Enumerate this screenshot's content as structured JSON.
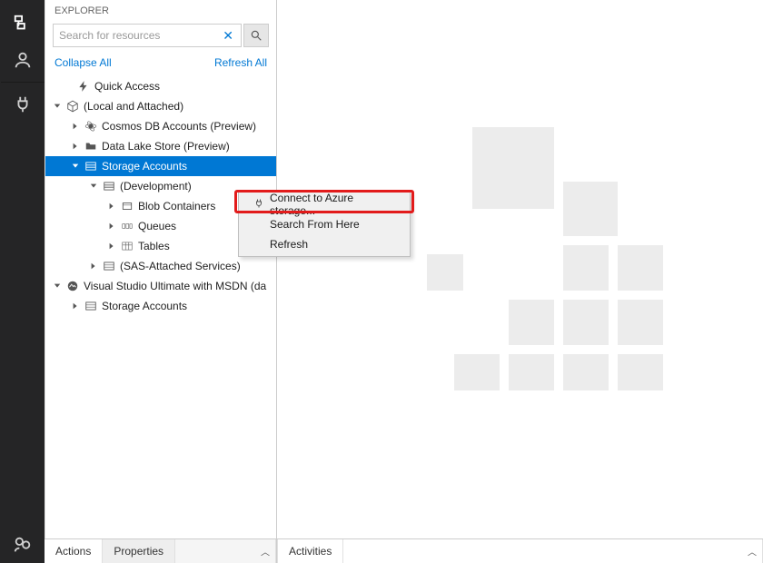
{
  "explorer": {
    "title": "EXPLORER"
  },
  "search": {
    "placeholder": "Search for resources"
  },
  "links": {
    "collapse": "Collapse All",
    "refresh": "Refresh All"
  },
  "tree": {
    "quick_access": "Quick Access",
    "local_attached": "(Local and Attached)",
    "cosmos": "Cosmos DB Accounts (Preview)",
    "datalake": "Data Lake Store (Preview)",
    "storage_accounts": "Storage Accounts",
    "development": "(Development)",
    "blob_containers": "Blob Containers",
    "queues": "Queues",
    "tables": "Tables",
    "sas_attached": "(SAS-Attached Services)",
    "vs_ultimate": "Visual Studio Ultimate with MSDN (da",
    "storage_accounts2": "Storage Accounts"
  },
  "context_menu": {
    "connect": "Connect to Azure storage...",
    "search_here": "Search From Here",
    "refresh": "Refresh"
  },
  "bottom": {
    "actions": "Actions",
    "properties": "Properties",
    "activities": "Activities"
  }
}
